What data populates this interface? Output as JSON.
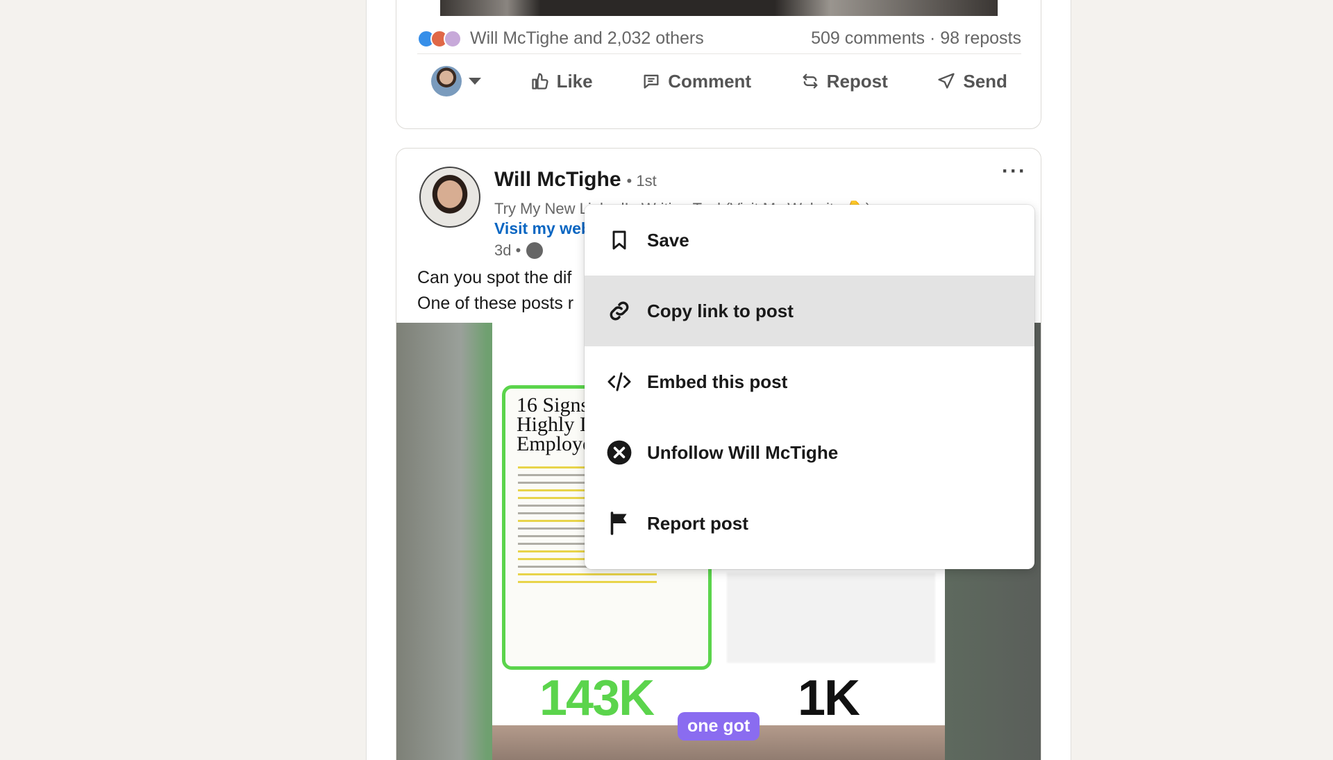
{
  "prev_post": {
    "reactions_text": "Will McTighe and 2,032 others",
    "engagement_text": "509 comments · 98 reposts",
    "actions": {
      "like": "Like",
      "comment": "Comment",
      "repost": "Repost",
      "send": "Send"
    }
  },
  "post": {
    "author": "Will McTighe",
    "degree": "• 1st",
    "headline": "Try My New LinkedIn Writing Tool (Visit My Website 👇)",
    "link_text": "Visit my web",
    "time": "3d •",
    "more_label": "···",
    "text_line1": "Can you spot the dif",
    "text_line2": "One of these posts r",
    "media": {
      "thumb_title_line1": "16 Signs",
      "thumb_title_line2": "Highly I",
      "thumb_title_line3": "Employe",
      "stat_left": "143K",
      "stat_right": "1K",
      "caption": "one got"
    }
  },
  "menu": {
    "items": [
      {
        "label": "Save",
        "icon": "bookmark-icon"
      },
      {
        "label": "Copy link to post",
        "icon": "link-icon"
      },
      {
        "label": "Embed this post",
        "icon": "code-icon"
      },
      {
        "label": "Unfollow Will McTighe",
        "icon": "close-circle-icon"
      },
      {
        "label": "Report post",
        "icon": "flag-icon"
      }
    ]
  },
  "colors": {
    "link": "#0a66c2",
    "stat_green": "#5bd44c",
    "caption_pill": "#8a6cf0",
    "menu_hover": "#e3e3e3"
  }
}
